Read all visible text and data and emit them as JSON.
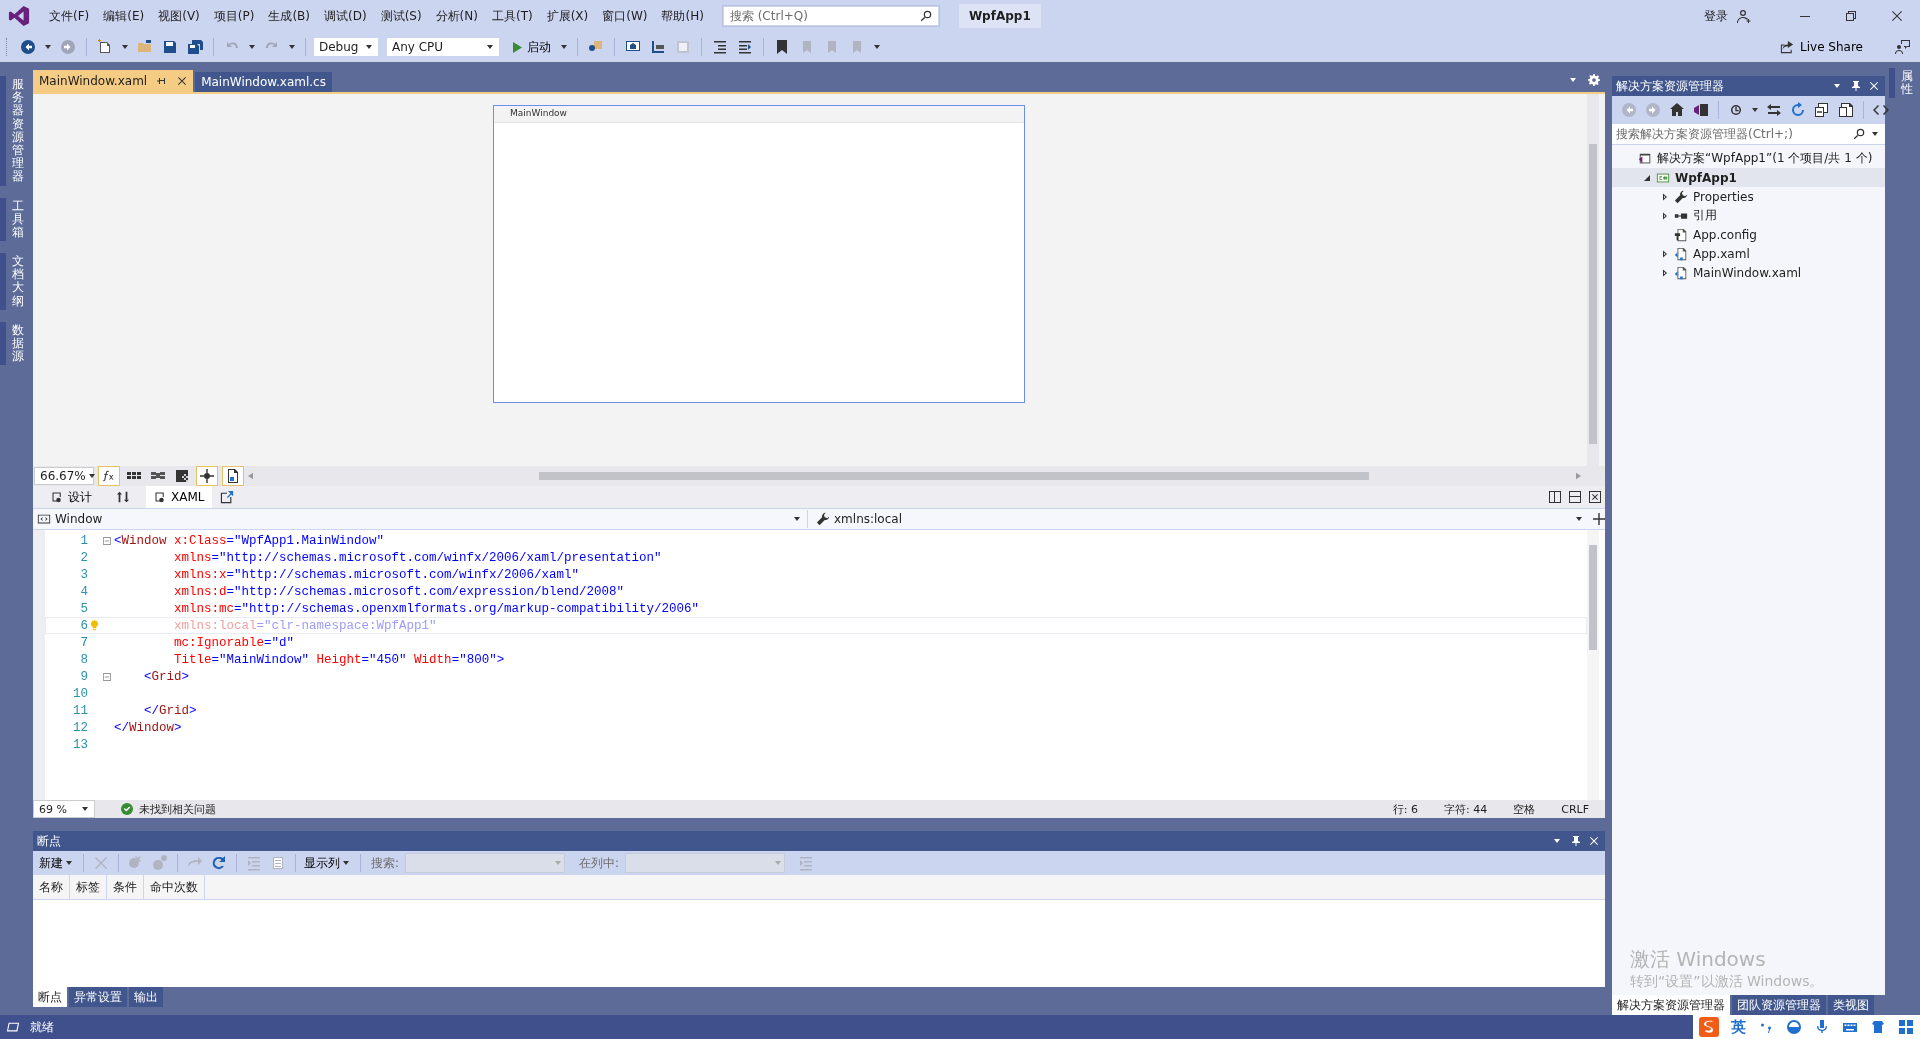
{
  "menu": {
    "items": [
      "文件(F)",
      "编辑(E)",
      "视图(V)",
      "项目(P)",
      "生成(B)",
      "调试(D)",
      "测试(S)",
      "分析(N)",
      "工具(T)",
      "扩展(X)",
      "窗口(W)",
      "帮助(H)"
    ],
    "search": {
      "placeholder": "搜索 (Ctrl+Q)"
    },
    "solution_name": "WpfApp1",
    "sign_in": "登录"
  },
  "toolbar": {
    "configuration": "Debug",
    "platform": "Any CPU",
    "start": "启动",
    "live_share": "Live Share"
  },
  "left_tabs": [
    "服务器资源管理器",
    "工具箱",
    "文档大纲",
    "数据源"
  ],
  "right_tabs": [
    "属性"
  ],
  "document_tabs": [
    {
      "label": "MainWindow.xaml",
      "selected": true
    },
    {
      "label": "MainWindow.xaml.cs",
      "selected": false
    }
  ],
  "designer": {
    "window_title": "MainWindow",
    "zoom": "66.67%"
  },
  "view_tabs": [
    {
      "label": "设计",
      "selected": false
    },
    {
      "label": "XAML",
      "selected": true
    }
  ],
  "nav_bar": {
    "element": "Window",
    "member": "xmlns:local"
  },
  "code": {
    "lines": [
      {
        "number": "1",
        "fold": true,
        "current": false,
        "dimmed": false,
        "lightbulb": false,
        "tokens": [
          {
            "kind": "bracket",
            "text": "<"
          },
          {
            "kind": "tag",
            "text": "Window"
          },
          {
            "kind": "attr",
            "text": " x:Class"
          },
          {
            "kind": "bracket",
            "text": "="
          },
          {
            "kind": "value",
            "text": "\"WpfApp1.MainWindow\""
          }
        ]
      },
      {
        "number": "2",
        "fold": false,
        "current": false,
        "dimmed": false,
        "lightbulb": false,
        "tokens": [
          {
            "kind": "attr",
            "text": "        xmlns"
          },
          {
            "kind": "bracket",
            "text": "="
          },
          {
            "kind": "value",
            "text": "\"http://schemas.microsoft.com/winfx/2006/xaml/presentation\""
          }
        ]
      },
      {
        "number": "3",
        "fold": false,
        "current": false,
        "dimmed": false,
        "lightbulb": false,
        "tokens": [
          {
            "kind": "attr",
            "text": "        xmlns:x"
          },
          {
            "kind": "bracket",
            "text": "="
          },
          {
            "kind": "value",
            "text": "\"http://schemas.microsoft.com/winfx/2006/xaml\""
          }
        ]
      },
      {
        "number": "4",
        "fold": false,
        "current": false,
        "dimmed": false,
        "lightbulb": false,
        "tokens": [
          {
            "kind": "attr",
            "text": "        xmlns:d"
          },
          {
            "kind": "bracket",
            "text": "="
          },
          {
            "kind": "value",
            "text": "\"http://schemas.microsoft.com/expression/blend/2008\""
          }
        ]
      },
      {
        "number": "5",
        "fold": false,
        "current": false,
        "dimmed": false,
        "lightbulb": false,
        "tokens": [
          {
            "kind": "attr",
            "text": "        xmlns:mc"
          },
          {
            "kind": "bracket",
            "text": "="
          },
          {
            "kind": "value",
            "text": "\"http://schemas.openxmlformats.org/markup-compatibility/2006\""
          }
        ]
      },
      {
        "number": "6",
        "fold": false,
        "current": true,
        "dimmed": true,
        "lightbulb": true,
        "tokens": [
          {
            "kind": "attr",
            "text": "        xmlns:local"
          },
          {
            "kind": "bracket",
            "text": "="
          },
          {
            "kind": "value",
            "text": "\"clr-namespace:WpfApp1\""
          }
        ]
      },
      {
        "number": "7",
        "fold": false,
        "current": false,
        "dimmed": false,
        "lightbulb": false,
        "tokens": [
          {
            "kind": "attr",
            "text": "        mc:Ignorable"
          },
          {
            "kind": "bracket",
            "text": "="
          },
          {
            "kind": "value",
            "text": "\"d\""
          }
        ]
      },
      {
        "number": "8",
        "fold": false,
        "current": false,
        "dimmed": false,
        "lightbulb": false,
        "tokens": [
          {
            "kind": "attr",
            "text": "        Title"
          },
          {
            "kind": "bracket",
            "text": "="
          },
          {
            "kind": "value",
            "text": "\"MainWindow\""
          },
          {
            "kind": "attr",
            "text": " Height"
          },
          {
            "kind": "bracket",
            "text": "="
          },
          {
            "kind": "value",
            "text": "\"450\""
          },
          {
            "kind": "attr",
            "text": " Width"
          },
          {
            "kind": "bracket",
            "text": "="
          },
          {
            "kind": "value",
            "text": "\"800\""
          },
          {
            "kind": "bracket",
            "text": ">"
          }
        ]
      },
      {
        "number": "9",
        "fold": true,
        "current": false,
        "dimmed": false,
        "lightbulb": false,
        "tokens": [
          {
            "kind": "bracket",
            "text": "    <"
          },
          {
            "kind": "tag",
            "text": "Grid"
          },
          {
            "kind": "bracket",
            "text": ">"
          }
        ]
      },
      {
        "number": "10",
        "fold": false,
        "current": false,
        "lightbulb": false
      },
      {
        "number": "11",
        "fold": false,
        "current": false,
        "dimmed": false,
        "lightbulb": false,
        "tokens": [
          {
            "kind": "bracket",
            "text": "    </"
          },
          {
            "kind": "tag",
            "text": "Grid"
          },
          {
            "kind": "bracket",
            "text": ">"
          }
        ]
      },
      {
        "number": "12",
        "fold": false,
        "current": false,
        "dimmed": false,
        "lightbulb": false,
        "tokens": [
          {
            "kind": "bracket",
            "text": "</"
          },
          {
            "kind": "tag",
            "text": "Window"
          },
          {
            "kind": "bracket",
            "text": ">"
          }
        ]
      },
      {
        "number": "13",
        "fold": false,
        "current": false,
        "lightbulb": false
      }
    ],
    "zoom": "69 %",
    "issues": "未找到相关问题",
    "line": "行: 6",
    "column": "字符: 44",
    "indent": "空格",
    "line_ending": "CRLF"
  },
  "breakpoints": {
    "title": "断点",
    "new": "新建",
    "show_columns": "显示列",
    "search_label": "搜索:",
    "in_column_label": "在列中:",
    "columns": [
      "名称",
      "标签",
      "条件",
      "命中次数"
    ]
  },
  "bottom_tabs": [
    {
      "label": "断点",
      "selected": true
    },
    {
      "label": "异常设置",
      "selected": false
    },
    {
      "label": "输出",
      "selected": false
    }
  ],
  "solution_explorer": {
    "title": "解决方案资源管理器",
    "search_placeholder": "搜索解决方案资源管理器(Ctrl+;)",
    "tree": [
      {
        "label": "解决方案“WpfApp1”(1 个项目/共 1 个)",
        "kind": "solution",
        "expandable": false,
        "expanded": true,
        "selected": false,
        "children": [
          {
            "label": "WpfApp1",
            "kind": "project",
            "expandable": true,
            "expanded": true,
            "selected": true,
            "children": [
              {
                "label": "Properties",
                "kind": "properties",
                "expandable": true,
                "expanded": false,
                "selected": false
              },
              {
                "label": "引用",
                "kind": "references",
                "expandable": true,
                "expanded": false,
                "selected": false
              },
              {
                "label": "App.config",
                "kind": "config",
                "expandable": false,
                "expanded": false,
                "selected": false
              },
              {
                "label": "App.xaml",
                "kind": "xaml",
                "expandable": true,
                "expanded": false,
                "selected": false
              },
              {
                "label": "MainWindow.xaml",
                "kind": "xaml",
                "expandable": true,
                "expanded": false,
                "selected": false
              }
            ]
          }
        ]
      }
    ]
  },
  "solution_tabs": [
    {
      "label": "解决方案资源管理器",
      "selected": true
    },
    {
      "label": "团队资源管理器",
      "selected": false
    },
    {
      "label": "类视图",
      "selected": false
    }
  ],
  "activation": {
    "title": "激活 Windows",
    "subtitle": "转到“设置”以激活 Windows。"
  },
  "status": {
    "text": "就绪"
  },
  "ime": {
    "mode": "英"
  }
}
